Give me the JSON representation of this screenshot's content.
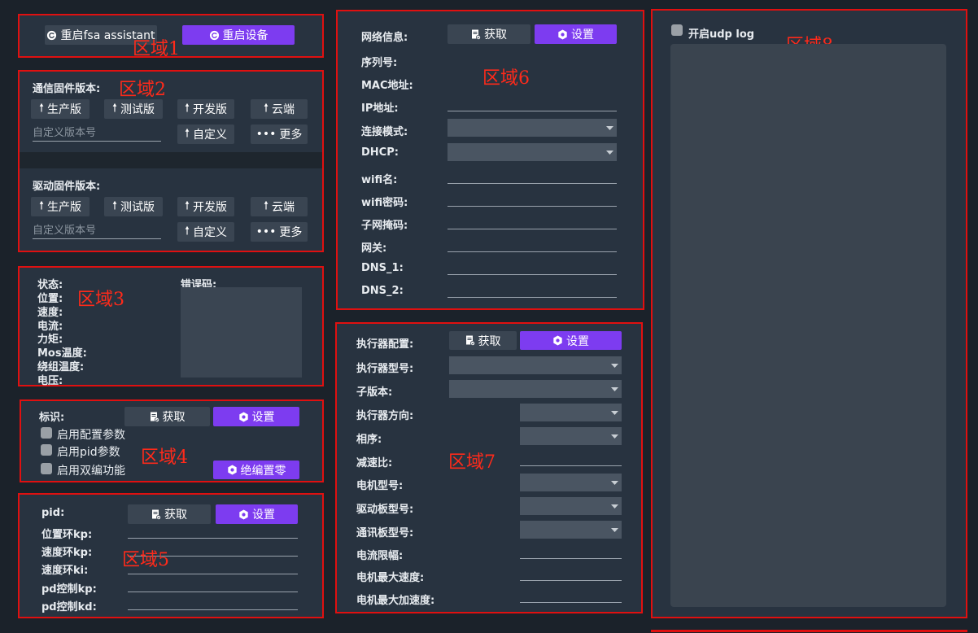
{
  "region_tags": [
    "区域1",
    "区域2",
    "区域3",
    "区域4",
    "区域5",
    "区域6",
    "区域7",
    "区域8"
  ],
  "r1": {
    "restart_assistant": "重启fsa assistant",
    "restart_device": "重启设备"
  },
  "r2": {
    "comm_title": "通信固件版本:",
    "drive_title": "驱动固件版本:",
    "production": "生产版",
    "test": "测试版",
    "dev": "开发版",
    "cloud": "云端",
    "custom": "自定义",
    "more": "更多",
    "custom_placeholder": "自定义版本号"
  },
  "r3": {
    "labels": [
      "状态:",
      "位置:",
      "速度:",
      "电流:",
      "力矩:",
      "Mos温度:",
      "绕组温度:",
      "电压:"
    ],
    "error_label": "错误码:"
  },
  "r4": {
    "id_label": "标识:",
    "get": "获取",
    "set": "设置",
    "checks": [
      "启用配置参数",
      "启用pid参数",
      "启用双编功能"
    ],
    "abs_zero": "绝编置零"
  },
  "r5": {
    "pid_label": "pid:",
    "get": "获取",
    "set": "设置",
    "labels": [
      "位置环kp:",
      "速度环kp:",
      "速度环ki:",
      "pd控制kp:",
      "pd控制kd:"
    ]
  },
  "r6": {
    "title": "网络信息:",
    "get": "获取",
    "set": "设置",
    "labels": [
      "序列号:",
      "MAC地址:",
      "IP地址:",
      "连接模式:",
      "DHCP:",
      "wifi名:",
      "wifi密码:",
      "子网掩码:",
      "网关:",
      "DNS_1:",
      "DNS_2:"
    ]
  },
  "r7": {
    "title": "执行器配置:",
    "get": "获取",
    "set": "设置",
    "labels": [
      "执行器型号:",
      "子版本:",
      "执行器方向:",
      "相序:",
      "减速比:",
      "电机型号:",
      "驱动板型号:",
      "通讯板型号:",
      "电流限幅:",
      "电机最大速度:",
      "电机最大加速度:"
    ]
  },
  "r8": {
    "udp_log": "开启udp log"
  },
  "colors": {
    "accent": "#7d3cf0",
    "border": "#e01010",
    "panel": "#283340",
    "button": "#3a4552"
  },
  "icons": [
    "restart-icon",
    "upload-arrow-icon",
    "more-dots-icon",
    "document-check-icon",
    "gear-hex-icon",
    "dropdown-arrow-icon"
  ]
}
